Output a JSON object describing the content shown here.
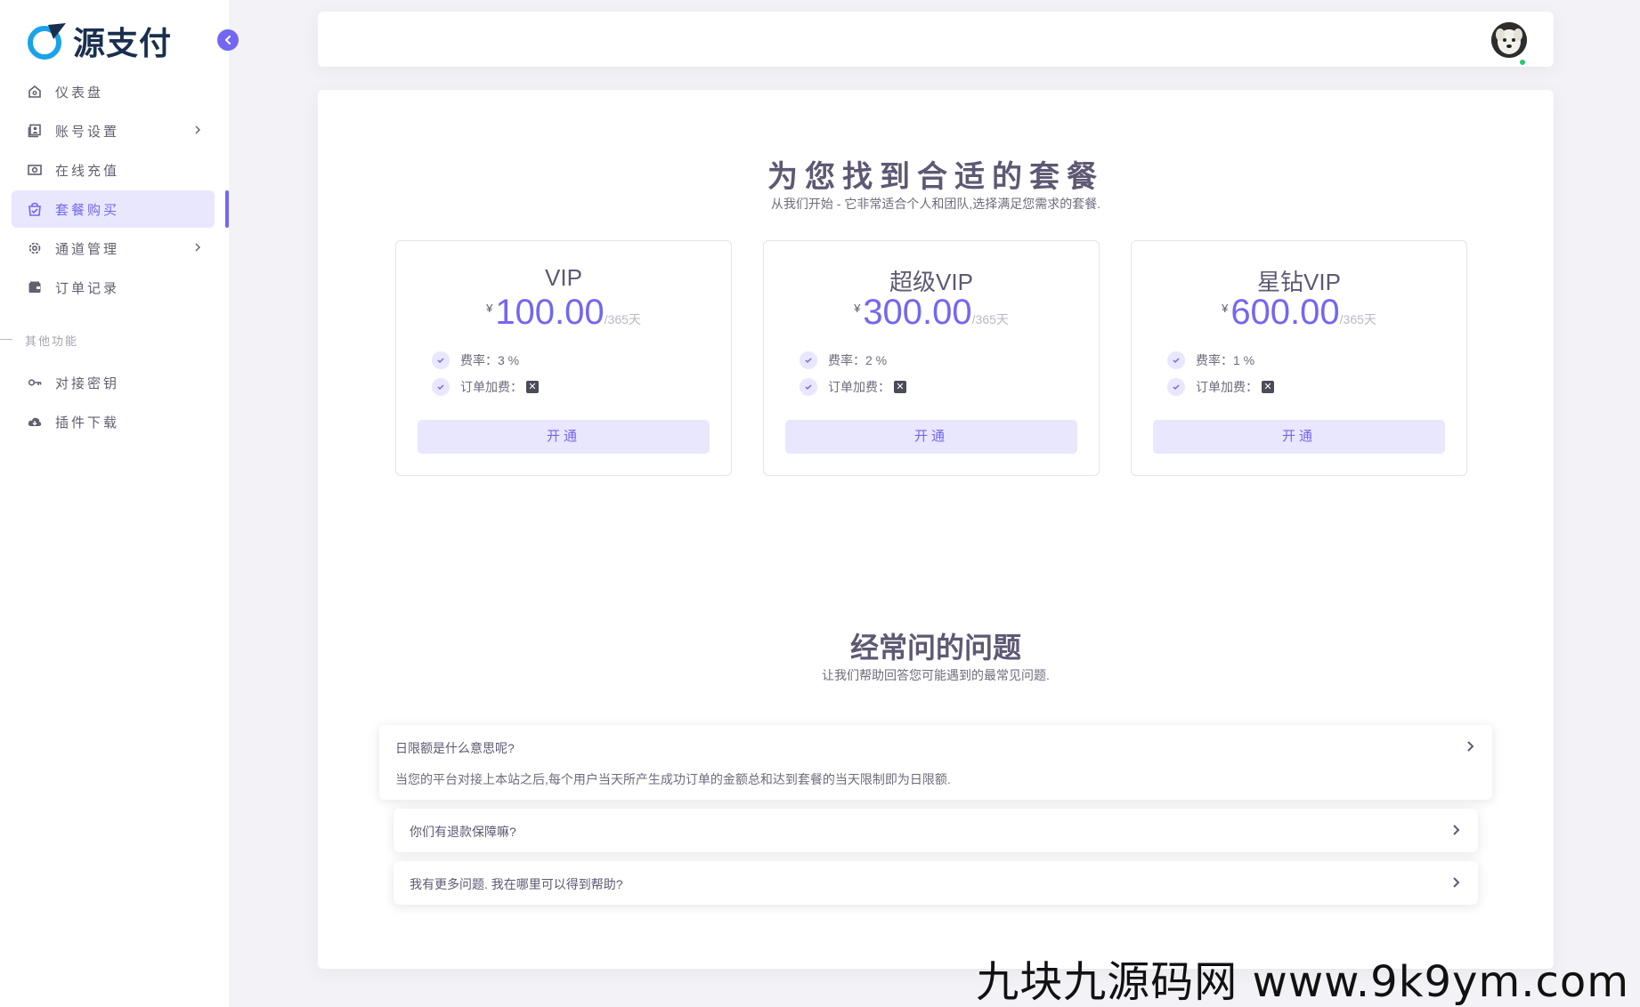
{
  "brand": {
    "logo_text": "源支付"
  },
  "sidebar": {
    "items": [
      {
        "label": "仪表盘",
        "icon": "home-icon",
        "expandable": false
      },
      {
        "label": "账号设置",
        "icon": "user-id-icon",
        "expandable": true
      },
      {
        "label": "在线充值",
        "icon": "money-icon",
        "expandable": false
      },
      {
        "label": "套餐购买",
        "icon": "shopping-bag-icon",
        "expandable": false,
        "active": true
      },
      {
        "label": "通道管理",
        "icon": "gear-icon",
        "expandable": true
      },
      {
        "label": "订单记录",
        "icon": "wallet-icon",
        "expandable": false
      }
    ],
    "section_label": "其他功能",
    "items2": [
      {
        "label": "对接密钥",
        "icon": "key-icon"
      },
      {
        "label": "插件下载",
        "icon": "cloud-download-icon"
      }
    ]
  },
  "pricing": {
    "title": "为您找到合适的套餐",
    "subtitle": "从我们开始 - 它非常适合个人和团队,选择满足您需求的套餐.",
    "plans": [
      {
        "name": "VIP",
        "currency": "¥",
        "price": "100.00",
        "period": "/365天",
        "fee_rate": "费率：3 %",
        "order_fee": "订单加费：",
        "button": "开通"
      },
      {
        "name": "超级VIP",
        "currency": "¥",
        "price": "300.00",
        "period": "/365天",
        "fee_rate": "费率：2 %",
        "order_fee": "订单加费：",
        "button": "开通"
      },
      {
        "name": "星钻VIP",
        "currency": "¥",
        "price": "600.00",
        "period": "/365天",
        "fee_rate": "费率：1 %",
        "order_fee": "订单加费：",
        "button": "开通"
      }
    ]
  },
  "faq": {
    "title": "经常问的问题",
    "subtitle": "让我们帮助回答您可能遇到的最常见问题.",
    "items": [
      {
        "q": "日限额是什么意思呢?",
        "a": "当您的平台对接上本站之后,每个用户当天所产生成功订单的金额总和达到套餐的当天限制即为日限额."
      },
      {
        "q": "你们有退款保障嘛?"
      },
      {
        "q": "我有更多问题. 我在哪里可以得到帮助?"
      }
    ]
  },
  "watermark": "九块九源码网 www.9k9ym.com",
  "colors": {
    "accent": "#7367f0",
    "accent_light": "#e8e7fd",
    "online": "#28c76f"
  }
}
